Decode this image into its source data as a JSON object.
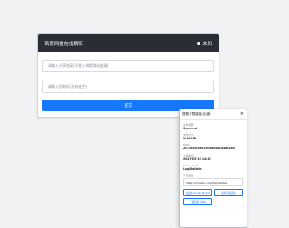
{
  "form": {
    "title": "百度网盘在线解析",
    "status": "未知",
    "share_link_placeholder": "请输入分享链接(可输入带提取码链接)",
    "code_placeholder": "请输入提取码(没有留空)",
    "submit_label": "提交"
  },
  "panel": {
    "title": "提取下载链接(出错)",
    "fields": [
      {
        "label": "文件名称",
        "value": "Sy.exe.zi"
      },
      {
        "label": "文件大小",
        "value": "1.44 MB"
      },
      {
        "label": "MD5",
        "value": "2c72b4fc59b1d3da0b81a4bb2b9"
      },
      {
        "label": "上传时间",
        "value": "2023-03-10 14:46"
      },
      {
        "label": "User-Agent",
        "value": "LogStatistic"
      }
    ],
    "link_label": "下载链接:",
    "link_value": "https://d.baidu.com/file/c4e6e2",
    "button_send": "发送到 Aria2 / Motrix",
    "button_copy": "复制下载链接",
    "button_dl": "下载链接 (IDM)"
  }
}
